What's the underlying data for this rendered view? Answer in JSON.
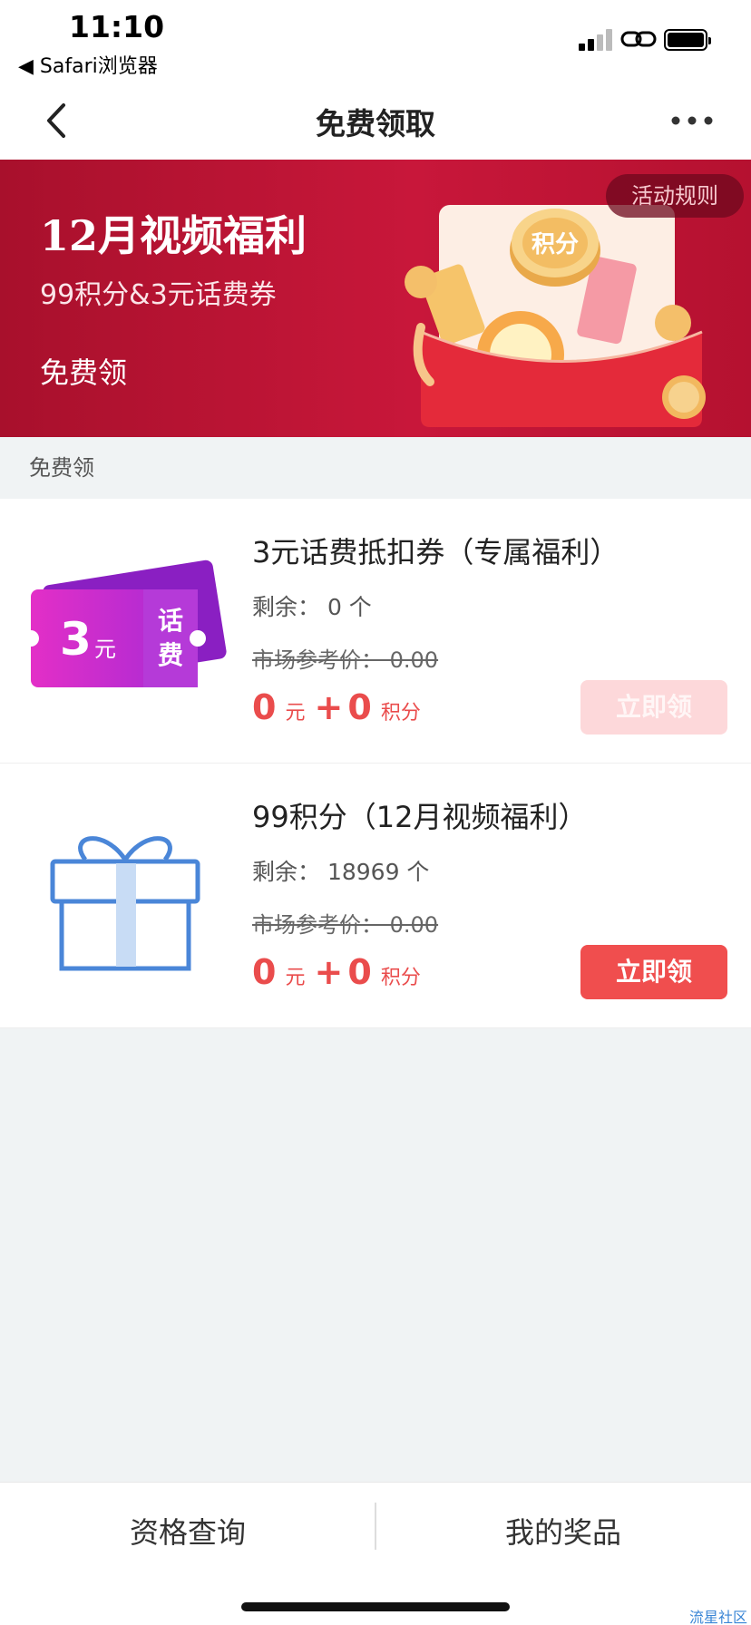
{
  "status_bar": {
    "time": "11:10",
    "back_app": "◀ Safari浏览器",
    "icons": [
      "signal-icon",
      "link-icon",
      "battery-icon"
    ]
  },
  "nav": {
    "title": "免费领取",
    "back_icon": "chevron-left-icon",
    "more_icon": "more-dots-icon"
  },
  "banner": {
    "title": "12月视频福利",
    "subtitle": "99积分&3元话费券",
    "cta": "免费领",
    "rules_label": "活动规则",
    "art_coin_text": "积分",
    "colors": {
      "background": "#c8173a",
      "accent": "#fbd9a0"
    }
  },
  "section_label": "免费领",
  "items": [
    {
      "title": "3元话费抵扣券（专属福利）",
      "stock": "剩余：  0 个",
      "market_price": "市场参考价：  0.00",
      "price_yuan": "0",
      "yuan_unit": "元",
      "plus": "+",
      "price_points": "0",
      "points_unit": "积分",
      "button_label": "立即领",
      "button_state": "disabled",
      "image": {
        "icon": "voucher-icon",
        "amount": "3",
        "unit": "元",
        "label_1": "话",
        "label_2": "费"
      }
    },
    {
      "title": "99积分（12月视频福利）",
      "stock": "剩余：  18969 个",
      "market_price": "市场参考价：  0.00",
      "price_yuan": "0",
      "yuan_unit": "元",
      "plus": "+",
      "price_points": "0",
      "points_unit": "积分",
      "button_label": "立即领",
      "button_state": "active",
      "image": {
        "icon": "gift-box-icon"
      }
    }
  ],
  "bottom_tabs": {
    "left": "资格查询",
    "right": "我的奖品"
  },
  "watermark": "流星社区",
  "colors": {
    "price_red": "#ea4c4c",
    "button_active": "#f04e4e",
    "button_disabled": "#fdd8da"
  }
}
